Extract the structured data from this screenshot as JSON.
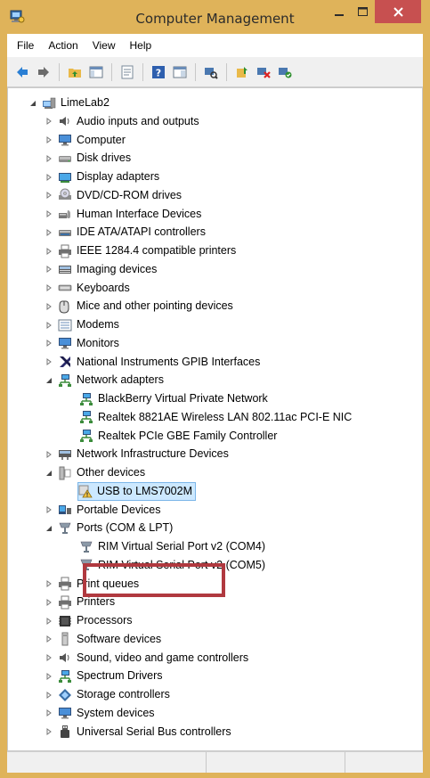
{
  "window": {
    "title": "Computer Management"
  },
  "menu": [
    {
      "label": "File"
    },
    {
      "label": "Action"
    },
    {
      "label": "View"
    },
    {
      "label": "Help"
    }
  ],
  "toolbar": [
    {
      "name": "back-button-icon",
      "icon": "arrow-left"
    },
    {
      "name": "forward-button-icon",
      "icon": "arrow-right"
    },
    {
      "name": "up-folder-icon",
      "icon": "folder-up"
    },
    {
      "name": "show-hide-tree-icon",
      "icon": "tree-view"
    },
    {
      "name": "properties-icon",
      "icon": "properties"
    },
    {
      "name": "help-icon",
      "icon": "help"
    },
    {
      "name": "console-view-icon",
      "icon": "view"
    },
    {
      "name": "scan-hardware-icon",
      "icon": "scan"
    },
    {
      "name": "update-driver-icon",
      "icon": "update-driver"
    },
    {
      "name": "uninstall-device-icon",
      "icon": "uninstall"
    },
    {
      "name": "enable-device-icon",
      "icon": "enable"
    }
  ],
  "tree": {
    "root": "LimeLab2",
    "nodes": [
      {
        "label": "Audio inputs and outputs",
        "icon": "speaker",
        "expanded": false
      },
      {
        "label": "Computer",
        "icon": "monitor",
        "expanded": false
      },
      {
        "label": "Disk drives",
        "icon": "disk",
        "expanded": false
      },
      {
        "label": "Display adapters",
        "icon": "display",
        "expanded": false
      },
      {
        "label": "DVD/CD-ROM drives",
        "icon": "dvd",
        "expanded": false
      },
      {
        "label": "Human Interface Devices",
        "icon": "hid",
        "expanded": false
      },
      {
        "label": "IDE ATA/ATAPI controllers",
        "icon": "ide",
        "expanded": false
      },
      {
        "label": "IEEE 1284.4 compatible printers",
        "icon": "printer",
        "expanded": false
      },
      {
        "label": "Imaging devices",
        "icon": "camera",
        "expanded": false
      },
      {
        "label": "Keyboards",
        "icon": "keyboard",
        "expanded": false
      },
      {
        "label": "Mice and other pointing devices",
        "icon": "mouse",
        "expanded": false
      },
      {
        "label": "Modems",
        "icon": "modem",
        "expanded": false
      },
      {
        "label": "Monitors",
        "icon": "monitor",
        "expanded": false
      },
      {
        "label": "National Instruments GPIB Interfaces",
        "icon": "ni",
        "expanded": false
      },
      {
        "label": "Network adapters",
        "icon": "network",
        "expanded": true,
        "children": [
          {
            "label": "BlackBerry Virtual Private Network",
            "icon": "network"
          },
          {
            "label": "Realtek 8821AE Wireless LAN 802.11ac PCI-E NIC",
            "icon": "network"
          },
          {
            "label": "Realtek PCIe GBE Family Controller",
            "icon": "network"
          }
        ]
      },
      {
        "label": "Network Infrastructure Devices",
        "icon": "network-infra",
        "expanded": false
      },
      {
        "label": "Other devices",
        "icon": "other",
        "expanded": true,
        "children": [
          {
            "label": "USB to LMS7002M",
            "icon": "warning-device",
            "selected": true
          }
        ]
      },
      {
        "label": "Portable Devices",
        "icon": "portable",
        "expanded": false
      },
      {
        "label": "Ports (COM & LPT)",
        "icon": "port",
        "expanded": true,
        "children": [
          {
            "label": "RIM Virtual Serial Port v2 (COM4)",
            "icon": "port"
          },
          {
            "label": "RIM Virtual Serial Port v2 (COM5)",
            "icon": "port"
          }
        ]
      },
      {
        "label": "Print queues",
        "icon": "printer",
        "expanded": false
      },
      {
        "label": "Printers",
        "icon": "printer",
        "expanded": false
      },
      {
        "label": "Processors",
        "icon": "processor",
        "expanded": false
      },
      {
        "label": "Software devices",
        "icon": "software",
        "expanded": false
      },
      {
        "label": "Sound, video and game controllers",
        "icon": "speaker",
        "expanded": false
      },
      {
        "label": "Spectrum Drivers",
        "icon": "network",
        "expanded": false
      },
      {
        "label": "Storage controllers",
        "icon": "storage",
        "expanded": false
      },
      {
        "label": "System devices",
        "icon": "monitor",
        "expanded": false
      },
      {
        "label": "Universal Serial Bus controllers",
        "icon": "usb",
        "expanded": false
      }
    ]
  },
  "colors": {
    "frame": "#dfb35a",
    "close_button": "#c75050",
    "selection_bg": "#cce8ff",
    "highlight_box": "#b0393f"
  }
}
